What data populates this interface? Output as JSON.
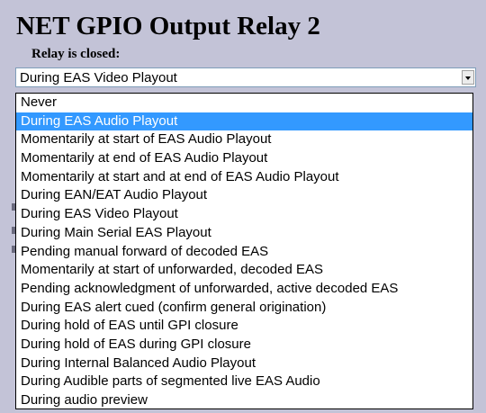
{
  "header": {
    "title": "NET GPIO Output Relay 2",
    "subtitle": "Relay is closed:"
  },
  "relay_select": {
    "value": "During EAS Video Playout",
    "options": [
      "Never",
      "During EAS Audio Playout",
      "Momentarily at start of EAS Audio Playout",
      "Momentarily at end of EAS Audio Playout",
      "Momentarily at start and at end of EAS Audio Playout",
      "During EAN/EAT Audio Playout",
      "During EAS Video Playout",
      "During Main Serial EAS Playout",
      "Pending manual forward of decoded EAS",
      "Momentarily at start of unforwarded, decoded EAS",
      "Pending acknowledgment of unforwarded, active decoded EAS",
      "During EAS alert cued (confirm general origination)",
      "During hold of EAS until GPI closure",
      "During hold of EAS during GPI closure",
      "During Internal Balanced Audio Playout",
      "During Audible parts of segmented live EAS Audio",
      "During audio preview"
    ],
    "highlighted_option": "During EAS Audio Playout"
  },
  "colors": {
    "background": "#c3c3d7",
    "highlight": "#3399ff"
  }
}
